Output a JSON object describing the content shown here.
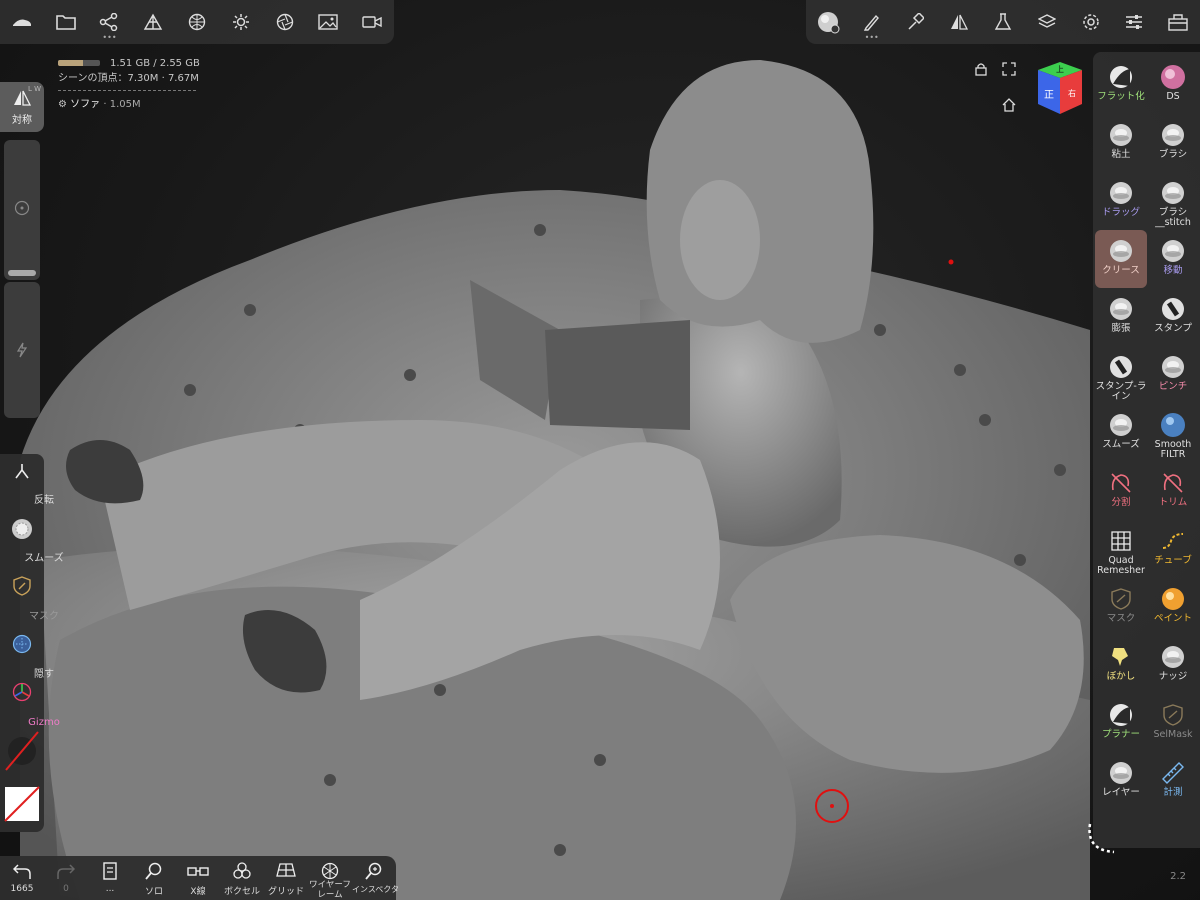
{
  "info": {
    "memory": "1.51 GB / 2.55 GB",
    "memory_fraction": 0.59,
    "scene_vertices": "シーンの頂点：7.30M · ",
    "scene_vertices_extra": "7.67M",
    "object_name": "ソファ",
    "object_count": "· 1.05M"
  },
  "left": {
    "symmetry": "対称",
    "symmetry_tiny": "L W",
    "invert": "反転",
    "smooth": "スムーズ",
    "mask": "マスク",
    "hide": "隠す",
    "gizmo": "Gizmo"
  },
  "right_tools": [
    {
      "label": "フラット化",
      "color": "#9fe07a"
    },
    {
      "label": "DS",
      "color": "#e0e0e0"
    },
    {
      "label": "粘土",
      "color": "#e0e0e0"
    },
    {
      "label": "ブラシ",
      "color": "#e0e0e0"
    },
    {
      "label": "ドラッグ",
      "color": "#a99cf0"
    },
    {
      "label": "ブラシ__stitch",
      "color": "#e0e0e0"
    },
    {
      "label": "クリース",
      "color": "#f0d0c8"
    },
    {
      "label": "移動",
      "color": "#a99cf0"
    },
    {
      "label": "膨張",
      "color": "#e0e0e0"
    },
    {
      "label": "スタンプ",
      "color": "#e0e0e0"
    },
    {
      "label": "スタンプ-ライン",
      "color": "#e0e0e0"
    },
    {
      "label": "ピンチ",
      "color": "#f08aa8"
    },
    {
      "label": "スムーズ",
      "color": "#e0e0e0"
    },
    {
      "label": "Smooth FILTR",
      "color": "#e0e0e0"
    },
    {
      "label": "分割",
      "color": "#f07080"
    },
    {
      "label": "トリム",
      "color": "#f07080"
    },
    {
      "label": "Quad Remesher",
      "color": "#e0e0e0"
    },
    {
      "label": "チューブ",
      "color": "#f0b830"
    },
    {
      "label": "マスク",
      "color": "#8a8a8a"
    },
    {
      "label": "ペイント",
      "color": "#f0b830"
    },
    {
      "label": "ぼかし",
      "color": "#f0e080"
    },
    {
      "label": "ナッジ",
      "color": "#e0e0e0"
    },
    {
      "label": "プラナー",
      "color": "#9fe07a"
    },
    {
      "label": "SelMask",
      "color": "#8a8a8a"
    },
    {
      "label": "レイヤー",
      "color": "#e0e0e0"
    },
    {
      "label": "計測",
      "color": "#7ab8f0"
    }
  ],
  "bottom": {
    "undo_count": "1665",
    "redo_count": "0",
    "history_dots": "...",
    "solo": "ソロ",
    "xray": "X線",
    "voxel": "ボクセル",
    "grid": "グリッド",
    "wireframe": "ワイヤーフレーム",
    "inspector": "インスペクタ"
  },
  "viewcube": {
    "front": "正",
    "top": "上",
    "right": "右"
  },
  "version": "2.2"
}
